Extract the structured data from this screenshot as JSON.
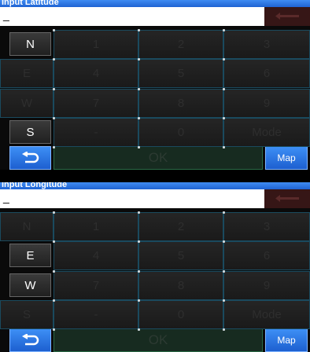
{
  "latitude_panel": {
    "title": "Input Latitude",
    "input_value": "_",
    "keys": [
      [
        "N",
        "1",
        "2",
        "3"
      ],
      [
        "E",
        "4",
        "5",
        "6"
      ],
      [
        "W",
        "7",
        "8",
        "9"
      ],
      [
        "S",
        "-",
        "0",
        "Mode"
      ]
    ],
    "active_keys": [
      "N",
      "S"
    ],
    "ok_label": "OK",
    "map_label": "Map"
  },
  "longitude_panel": {
    "title": "Input Longitude",
    "input_value": "_",
    "keys": [
      [
        "N",
        "1",
        "2",
        "3"
      ],
      [
        "E",
        "4",
        "5",
        "6"
      ],
      [
        "W",
        "7",
        "8",
        "9"
      ],
      [
        "S",
        "-",
        "0",
        "Mode"
      ]
    ],
    "active_keys": [
      "E",
      "W"
    ],
    "ok_label": "OK",
    "map_label": "Map"
  },
  "colors": {
    "title_bar": "#2a72e0",
    "key_active_text": "#ffffff",
    "key_disabled_text": "#2e2e2e",
    "ok_button": "#172b20",
    "blue_button": "#2a72e0"
  },
  "icons": {
    "back": "return-arrow-icon",
    "backspace": "backspace-arrow-icon"
  }
}
